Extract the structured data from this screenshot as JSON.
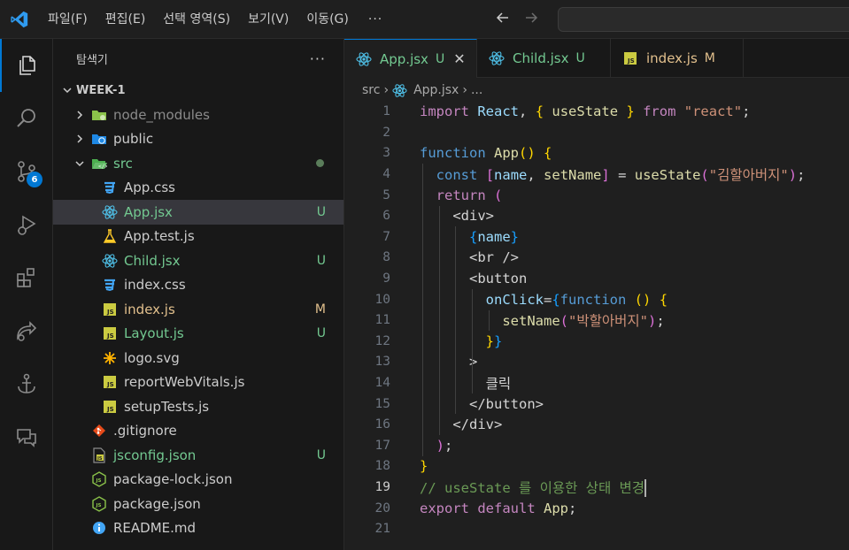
{
  "menu": {
    "items": [
      "파일(F)",
      "편집(E)",
      "선택 영역(S)",
      "보기(V)",
      "이동(G)"
    ],
    "more": "···"
  },
  "activity_bar": {
    "items": [
      "explorer-icon",
      "search-icon",
      "source-control-icon",
      "run-debug-icon",
      "extensions-icon",
      "remote-icon",
      "anchor-icon",
      "chat-icon"
    ],
    "source_control_badge": "6"
  },
  "sidebar": {
    "title": "탐색기",
    "more": "···",
    "section": "WEEK-1",
    "items": [
      {
        "name": "node_modules",
        "kind": "folder",
        "status": ""
      },
      {
        "name": "public",
        "kind": "folder",
        "status": ""
      },
      {
        "name": "src",
        "kind": "folder-open",
        "status": ""
      },
      {
        "name": "App.css",
        "kind": "css",
        "status": ""
      },
      {
        "name": "App.jsx",
        "kind": "react",
        "status": "U"
      },
      {
        "name": "App.test.js",
        "kind": "test",
        "status": ""
      },
      {
        "name": "Child.jsx",
        "kind": "react",
        "status": "U"
      },
      {
        "name": "index.css",
        "kind": "css",
        "status": ""
      },
      {
        "name": "index.js",
        "kind": "js",
        "status": "M"
      },
      {
        "name": "Layout.js",
        "kind": "js",
        "status": "U"
      },
      {
        "name": "logo.svg",
        "kind": "svg",
        "status": ""
      },
      {
        "name": "reportWebVitals.js",
        "kind": "js",
        "status": ""
      },
      {
        "name": "setupTests.js",
        "kind": "js",
        "status": ""
      },
      {
        "name": ".gitignore",
        "kind": "git",
        "status": ""
      },
      {
        "name": "jsconfig.json",
        "kind": "jsconfig",
        "status": "U"
      },
      {
        "name": "package-lock.json",
        "kind": "json",
        "status": ""
      },
      {
        "name": "package.json",
        "kind": "json",
        "status": ""
      },
      {
        "name": "README.md",
        "kind": "info",
        "status": ""
      }
    ]
  },
  "tabs": [
    {
      "label": "App.jsx",
      "status": "U",
      "close": "✕"
    },
    {
      "label": "Child.jsx",
      "status": "U"
    },
    {
      "label": "index.js",
      "status": "M"
    }
  ],
  "breadcrumb": {
    "folder": "src",
    "file": "App.jsx",
    "sep": "›",
    "tail": "..."
  },
  "editor": {
    "current_line": 19,
    "line_numbers": [
      "1",
      "2",
      "3",
      "4",
      "5",
      "6",
      "7",
      "8",
      "9",
      "10",
      "11",
      "12",
      "13",
      "14",
      "15",
      "16",
      "17",
      "18",
      "19",
      "20",
      "21"
    ],
    "lines": [
      "import React, { useState } from \"react\";",
      "",
      "function App() {",
      "  const [name, setName] = useState(\"김할아버지\");",
      "  return (",
      "    <div>",
      "      {name}",
      "      <br />",
      "      <button",
      "        onClick={function () {",
      "          setName(\"박할아버지\");",
      "        }}",
      "      >",
      "        클릭",
      "      </button>",
      "    </div>",
      "  );",
      "}",
      "// useState 를 이용한 상태 변경",
      "export default App;",
      ""
    ]
  },
  "colors": {
    "accent": "#0078d4",
    "untracked": "#73c991",
    "modified": "#e2c08d",
    "react": "#4fc1e9",
    "js_badge": "#cbcb41",
    "css": "#42a5f5"
  }
}
